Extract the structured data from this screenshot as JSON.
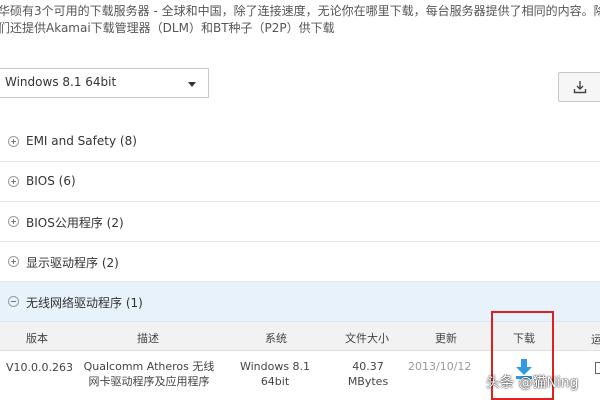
{
  "intro": {
    "line1": "华硕有3个可用的下载服务器 - 全球和中国，除了连接速度，无论你在哪里下载，每台服务器提供了相同的内容。除此",
    "line2": "们还提供Akamai下载管理器（DLM）和BT种子（P2P）供下载"
  },
  "os_select": {
    "value": "Windows 8.1 64bit"
  },
  "download_all_icon": "download-tray-icon",
  "sections": [
    {
      "label": "EMI and Safety",
      "count": "(8)",
      "expanded": false
    },
    {
      "label": "BIOS",
      "count": "(6)",
      "expanded": false
    },
    {
      "label": "BIOS公用程序",
      "count": "(2)",
      "expanded": false
    },
    {
      "label": "显示驱动程序",
      "count": "(2)",
      "expanded": false
    },
    {
      "label": "无线网络驱动程序",
      "count": "(1)",
      "expanded": true
    }
  ],
  "table": {
    "headers": {
      "version": "版本",
      "desc": "描述",
      "system": "系统",
      "size": "文件大小",
      "updated": "更新",
      "download": "下载",
      "extra": "运"
    },
    "row": {
      "version": "V10.0.0.263",
      "desc1": "Qualcomm Atheros 无线",
      "desc2": "网卡驱动程序及应用程序",
      "sys1": "Windows 8.1",
      "sys2": "64bit",
      "size1": "40.37",
      "size2": "MBytes",
      "date": "2013/10/12"
    }
  },
  "watermark": "头条 @猫Ning",
  "colors": {
    "active_section_bg": "#e7f2fb",
    "highlight_box": "#e02020",
    "download_icon": "#2f9be0"
  }
}
